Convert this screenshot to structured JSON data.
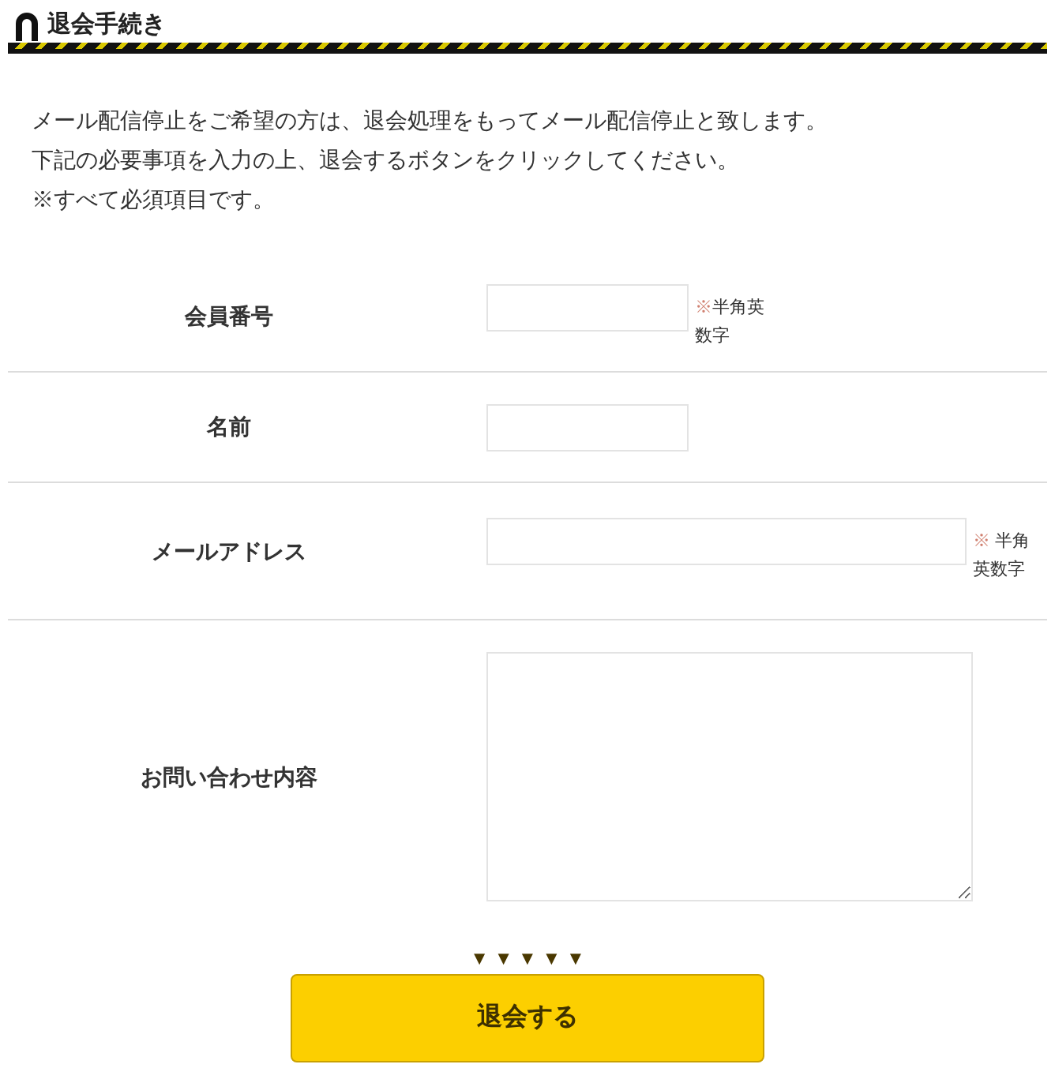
{
  "heading": {
    "title": "退会手続き"
  },
  "intro": [
    "メール配信停止をご希望の方は、退会処理をもってメール配信停止と致します。",
    "下記の必要事項を入力の上、退会するボタンをクリックしてください。",
    "※すべて必須項目です。"
  ],
  "fields": [
    {
      "label": "会員番号",
      "kind": "short",
      "note": {
        "mark": "※",
        "text": "半角英数字"
      }
    },
    {
      "label": "名前",
      "kind": "short"
    },
    {
      "label": "メールアドレス",
      "kind": "long",
      "note": {
        "mark": "※",
        "text": " 半角英数字"
      }
    },
    {
      "label": "お問い合わせ内容",
      "kind": "textarea"
    }
  ],
  "arrows": "▼ ▼ ▼ ▼ ▼",
  "submit": {
    "label": "退会する"
  }
}
